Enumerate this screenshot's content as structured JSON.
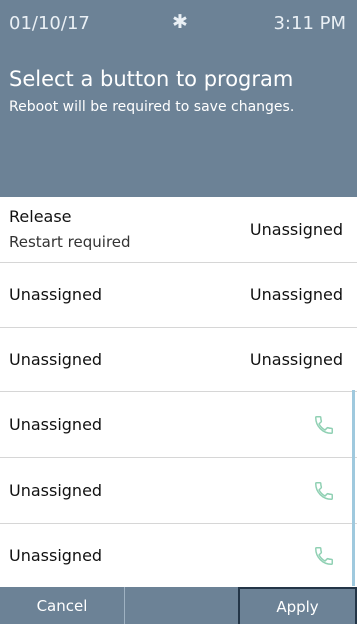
{
  "status": {
    "date": "01/10/17",
    "bluetooth_icon": "bluetooth-icon",
    "time": "3:11 PM"
  },
  "header": {
    "title": "Select a button to program",
    "subtitle": "Reboot will be required to save changes."
  },
  "rows": [
    {
      "left": "Release",
      "sub": "Restart required",
      "right": "Unassigned"
    },
    {
      "left": "Unassigned",
      "right": "Unassigned"
    },
    {
      "left": "Unassigned",
      "right": "Unassigned"
    },
    {
      "left": "Unassigned",
      "right_icon": "phone-icon"
    },
    {
      "left": "Unassigned",
      "right_icon": "phone-icon"
    },
    {
      "left": "Unassigned",
      "right_icon": "phone-icon"
    }
  ],
  "buttons": {
    "cancel": "Cancel",
    "apply": "Apply"
  },
  "colors": {
    "header_bg": "#6c8296",
    "phone_icon": "#8fd0b3",
    "accent_border": "#233547"
  }
}
